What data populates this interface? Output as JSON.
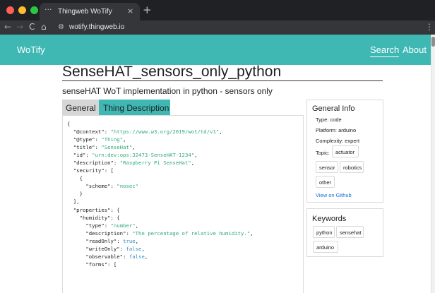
{
  "browser": {
    "tab_title": "Thingweb WoTify",
    "tab_favicon": "···",
    "tab_close": "×",
    "new_tab": "+",
    "url": "wotify.thingweb.io",
    "icons": [
      "back-icon",
      "forward-icon",
      "reload-icon",
      "home-icon",
      "site-info-icon",
      "menu-icon"
    ]
  },
  "header": {
    "brand": "WoTify",
    "nav": [
      "Search",
      "About"
    ]
  },
  "thing": {
    "title": "SenseHAT_sensors_only_python",
    "subtitle": "senseHAT WoT implementation in python - sensors only"
  },
  "tabs": [
    "General",
    "Thing Description"
  ],
  "td_lines": [
    [
      [
        "k",
        "{"
      ]
    ],
    [
      [
        "k",
        "  \"@context\": "
      ],
      [
        "s",
        "\"https://www.w3.org/2019/wot/td/v1\""
      ],
      [
        "k",
        ","
      ]
    ],
    [
      [
        "k",
        "  \"@type\": "
      ],
      [
        "s",
        "\"Thing\""
      ],
      [
        "k",
        ","
      ]
    ],
    [
      [
        "k",
        "  \"title\": "
      ],
      [
        "s",
        "\"SenseHat\""
      ],
      [
        "k",
        ","
      ]
    ],
    [
      [
        "k",
        "  \"id\": "
      ],
      [
        "s",
        "\"urn:dev:ops:32473-SenseHAT-1234\""
      ],
      [
        "k",
        ","
      ]
    ],
    [
      [
        "k",
        "  \"description\": "
      ],
      [
        "s",
        "\"Raspberry Pi SenseHat\""
      ],
      [
        "k",
        ","
      ]
    ],
    [
      [
        "k",
        "  \"security\": ["
      ]
    ],
    [
      [
        "k",
        "    {"
      ]
    ],
    [
      [
        "k",
        "      \"scheme\": "
      ],
      [
        "s",
        "\"nosec\""
      ]
    ],
    [
      [
        "k",
        "    }"
      ]
    ],
    [
      [
        "k",
        "  ],"
      ]
    ],
    [
      [
        "k",
        "  \"properties\": {"
      ]
    ],
    [
      [
        "k",
        "    \"humidity\": {"
      ]
    ],
    [
      [
        "k",
        "      \"type\": "
      ],
      [
        "s",
        "\"number\""
      ],
      [
        "k",
        ","
      ]
    ],
    [
      [
        "k",
        "      \"description\": "
      ],
      [
        "s",
        "\"The percentage of relative humidity.\""
      ],
      [
        "k",
        ","
      ]
    ],
    [
      [
        "k",
        "      \"readOnly\": "
      ],
      [
        "b",
        "true"
      ],
      [
        "k",
        ","
      ]
    ],
    [
      [
        "k",
        "      \"writeOnly\": "
      ],
      [
        "b",
        "false"
      ],
      [
        "k",
        ","
      ]
    ],
    [
      [
        "k",
        "      \"observable\": "
      ],
      [
        "b",
        "false"
      ],
      [
        "k",
        ","
      ]
    ],
    [
      [
        "k",
        "      \"forms\": ["
      ]
    ]
  ],
  "general_info": {
    "heading": "General Info",
    "type": "Type: code",
    "platform": "Platform: arduino",
    "complexity": "Complexity: expert",
    "topic_label": "Topic:",
    "topics": [
      "actuator",
      "sensor",
      "robotics",
      "other"
    ],
    "github_link": "View on Github"
  },
  "keywords": {
    "heading": "Keywords",
    "items": [
      "python",
      "sensehat",
      "arduino"
    ]
  },
  "colors": {
    "accent": "#3fb8b3",
    "json_string": "#2eaa7a",
    "json_boolean": "#2f8fbf",
    "link": "#1a6fd1"
  }
}
